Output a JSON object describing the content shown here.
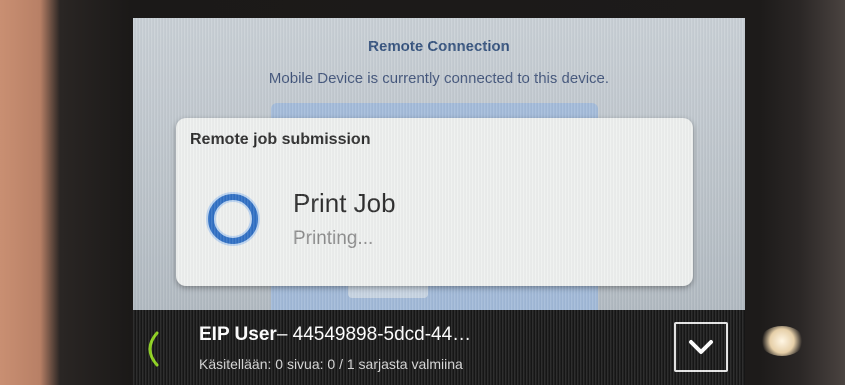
{
  "remote_connection": {
    "title": "Remote Connection",
    "subtitle": "Mobile Device is currently connected to this device."
  },
  "dialog": {
    "title": "Remote job submission",
    "job_title": "Print Job",
    "job_status": "Printing..."
  },
  "job_bar": {
    "user": "EIP User",
    "job_id": "– 44549898-5dcd-44…",
    "progress_text": "Käsitellään: 0 sivua: 0 / 1 sarjasta valmiina"
  },
  "icons": {
    "spinner": "progress-ring-icon",
    "expand": "chevron-down-icon"
  },
  "colors": {
    "spinner_blue": "#2f6fc4",
    "bar_spinner_green": "#8cd11b",
    "title_blue": "#32507c"
  }
}
